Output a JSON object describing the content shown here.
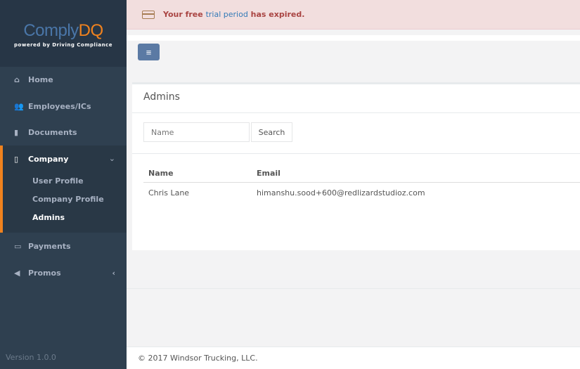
{
  "brand": {
    "name_a": "Comply",
    "name_b": "DQ",
    "tagline": "powered by Driving Compliance"
  },
  "sidebar": {
    "items": [
      {
        "label": "Home",
        "icon": "home-icon"
      },
      {
        "label": "Employees/ICs",
        "icon": "users-icon"
      },
      {
        "label": "Documents",
        "icon": "document-icon"
      },
      {
        "label": "Company",
        "icon": "building-icon"
      },
      {
        "label": "Payments",
        "icon": "credit-card-icon"
      },
      {
        "label": "Promos",
        "icon": "bullhorn-icon"
      }
    ],
    "company_sub": [
      {
        "label": "User Profile"
      },
      {
        "label": "Company Profile"
      },
      {
        "label": "Admins"
      }
    ],
    "version": "Version 1.0.0"
  },
  "alert": {
    "pre": "Your free ",
    "link": "trial period",
    "post": " has expired."
  },
  "page": {
    "title": "Admins",
    "search_placeholder": "Name",
    "search_button": "Search"
  },
  "table": {
    "headers": [
      "Name",
      "Email"
    ],
    "rows": [
      [
        "Chris Lane",
        "himanshu.sood+600@redlizardstudioz.com"
      ]
    ]
  },
  "footer": "© 2017 Windsor Trucking, LLC."
}
